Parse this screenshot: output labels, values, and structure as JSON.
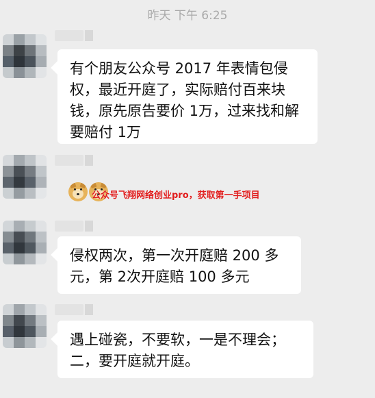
{
  "timestamp": "昨天 下午 6:25",
  "messages": [
    {
      "text": "有个朋友公众号 2017 年表情包侵权，最近开庭了，实际赔付百来块钱，原先原告要价 1万，过来找和解要赔付 1万"
    },
    {
      "emoji": [
        "doge-face-icon",
        "doge-face-icon"
      ]
    },
    {
      "text": "侵权两次，第一次开庭赔 200 多元，第 2次开庭赔 100 多元"
    },
    {
      "text": "遇上碰瓷，不要软，一是不理会；二，要开庭就开庭。"
    }
  ],
  "watermark": "公众号飞翔网络创业pro，获取第一手项目",
  "colors": {
    "background": "#ededed",
    "bubble": "#ffffff",
    "text": "#111111",
    "timestamp": "#a9a9a9",
    "watermark": "#e01c1c"
  }
}
